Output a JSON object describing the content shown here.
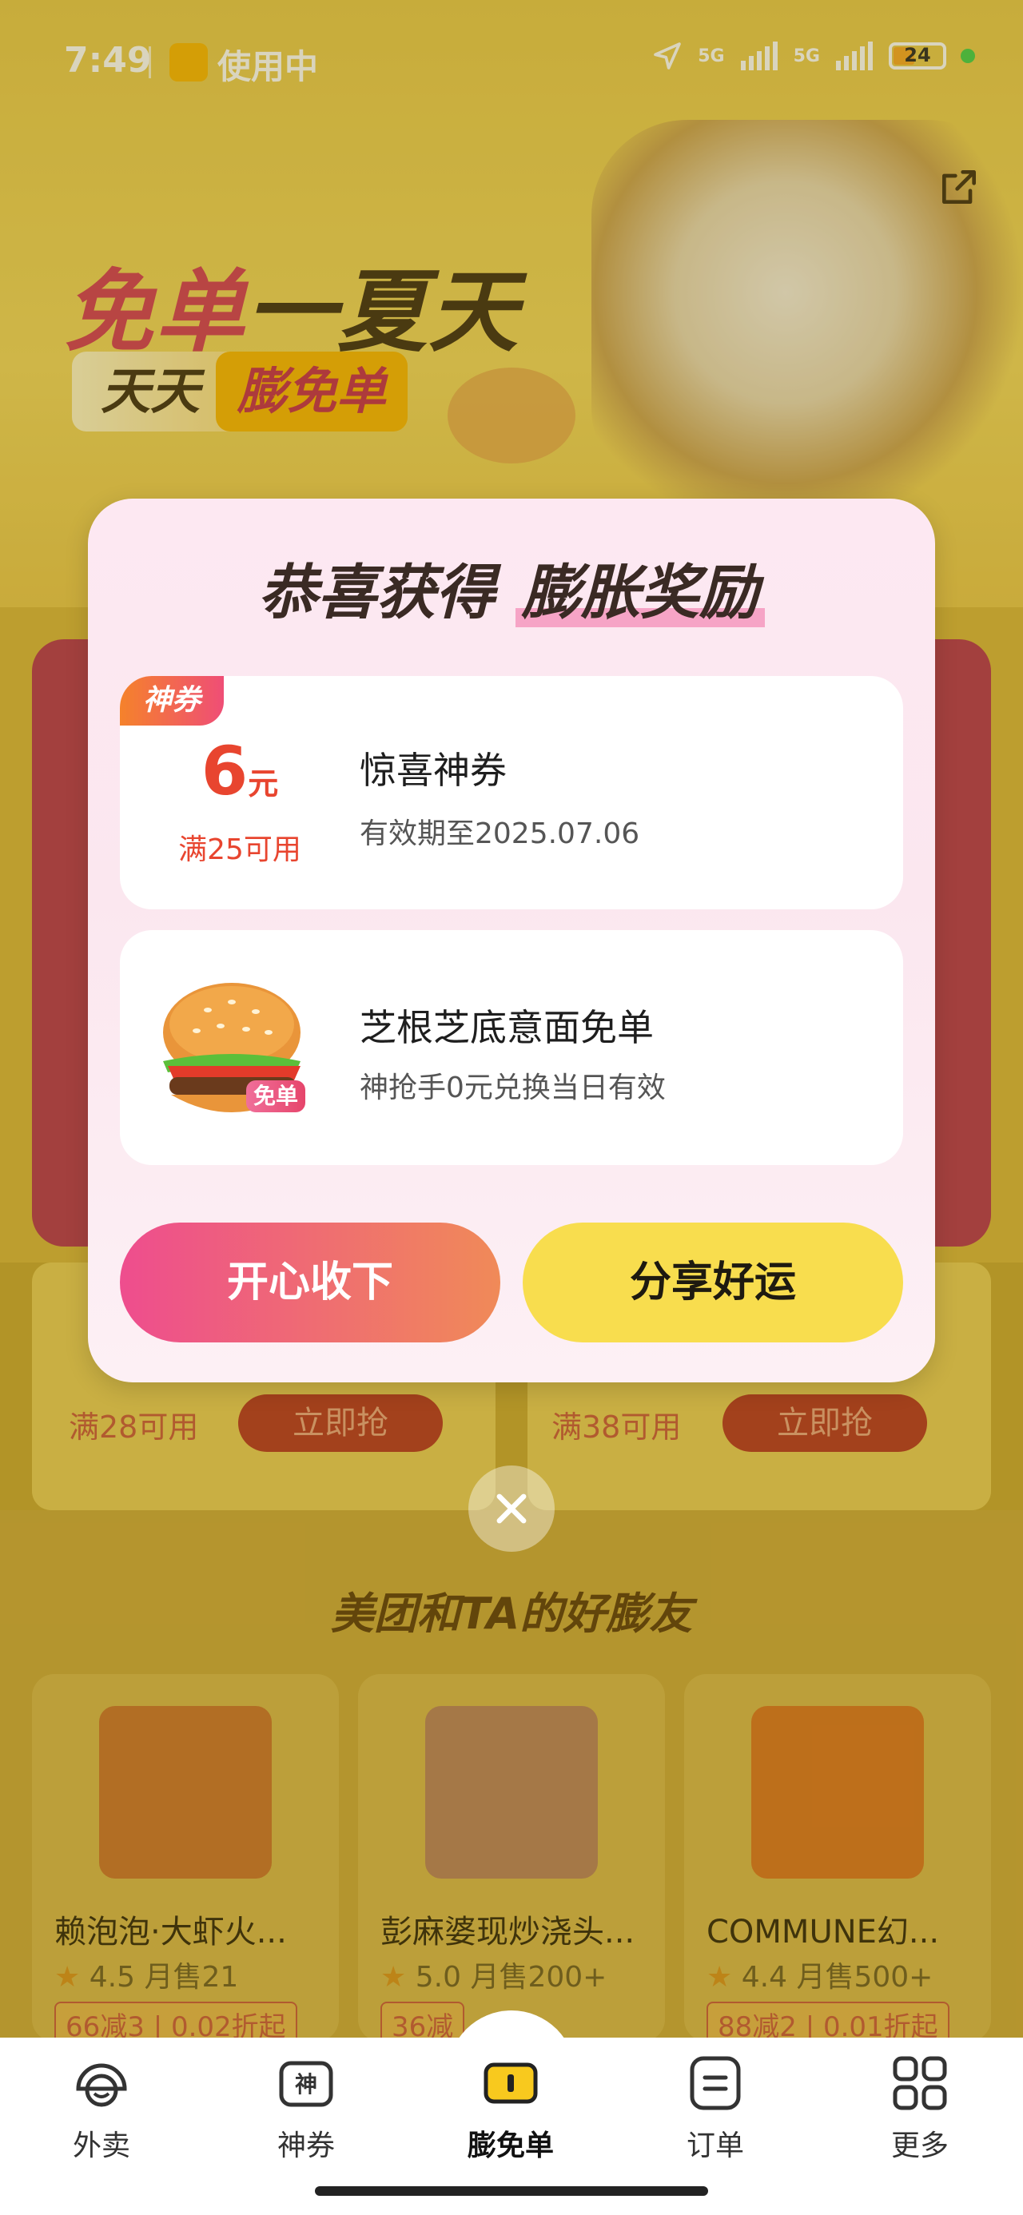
{
  "status_bar": {
    "time": "7:49",
    "app_status": "使用中",
    "signal1": "5G",
    "signal2": "5G",
    "battery": "24"
  },
  "hero": {
    "title_part1": "免单",
    "title_part2": "一夏天",
    "sub_left": "天天",
    "sub_right": "膨免单"
  },
  "dialog": {
    "title_plain": "恭喜获得",
    "title_highlight": "膨胀奖励",
    "coupon": {
      "badge": "神券",
      "amount": "6",
      "unit": "元",
      "condition": "满25可用",
      "name": "惊喜神券",
      "validity": "有效期至2025.07.06"
    },
    "free_item": {
      "badge": "免单",
      "name": "芝根芝底意面免单",
      "desc": "神抢手0元兑换当日有效"
    },
    "accept_label": "开心收下",
    "share_label": "分享好运"
  },
  "background": {
    "coupon_cards": [
      {
        "condition": "满28可用",
        "button": "立即抢"
      },
      {
        "condition": "满38可用",
        "button": "立即抢"
      }
    ],
    "section_title": "美团和TA的好膨友",
    "shops": [
      {
        "name": "赖泡泡·大虾火...",
        "rating": "4.5",
        "sales": "月售21",
        "tag": "66减3 | 0.02折起"
      },
      {
        "name": "彭麻婆现炒浇头...",
        "rating": "5.0",
        "sales": "月售200+",
        "tag": "36减"
      },
      {
        "name": "COMMUNE幻...",
        "rating": "4.4",
        "sales": "月售500+",
        "tag": "88减2 | 0.01折起"
      }
    ]
  },
  "nav": {
    "items": [
      {
        "label": "外卖",
        "icon": "takeaway-icon"
      },
      {
        "label": "神券",
        "icon": "coupon-icon"
      },
      {
        "label": "膨免单",
        "icon": "free-order-icon"
      },
      {
        "label": "订单",
        "icon": "order-icon"
      },
      {
        "label": "更多",
        "icon": "more-grid-icon"
      }
    ]
  }
}
